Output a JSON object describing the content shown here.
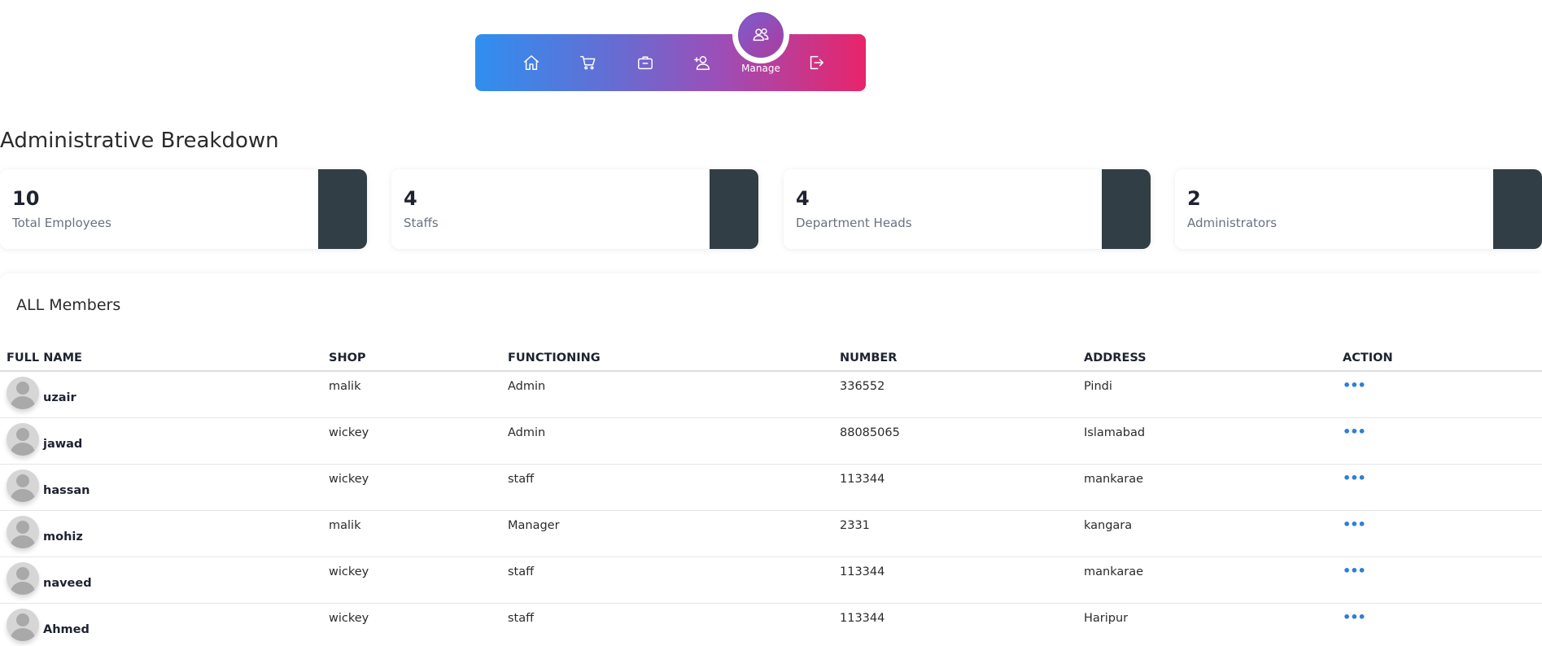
{
  "nav": {
    "items": [
      {
        "icon": "home-icon"
      },
      {
        "icon": "cart-icon"
      },
      {
        "icon": "briefcase-icon"
      },
      {
        "icon": "add-user-icon"
      },
      {
        "icon": "logout-icon"
      }
    ],
    "active": {
      "icon": "users-icon",
      "label": "Manage"
    },
    "gradient": [
      "#2f8ff0",
      "#e8246a"
    ]
  },
  "page": {
    "title": "Administrative Breakdown"
  },
  "stats": [
    {
      "value": "10",
      "label": "Total Employees"
    },
    {
      "value": "4",
      "label": "Staffs"
    },
    {
      "value": "4",
      "label": "Department Heads"
    },
    {
      "value": "2",
      "label": "Administrators"
    }
  ],
  "members": {
    "title": "ALL Members",
    "columns": [
      "FULL NAME",
      "SHOP",
      "FUNCTIONING",
      "NUMBER",
      "ADDRESS",
      "ACTION"
    ],
    "rows": [
      {
        "name": "uzair",
        "shop": "malik",
        "functioning": "Admin",
        "number": "336552",
        "address": "Pindi"
      },
      {
        "name": "jawad",
        "shop": "wickey",
        "functioning": "Admin",
        "number": "88085065",
        "address": "Islamabad"
      },
      {
        "name": "hassan",
        "shop": "wickey",
        "functioning": "staff",
        "number": "113344",
        "address": "mankarae"
      },
      {
        "name": "mohiz",
        "shop": "malik",
        "functioning": "Manager",
        "number": "2331",
        "address": "kangara"
      },
      {
        "name": "naveed",
        "shop": "wickey",
        "functioning": "staff",
        "number": "113344",
        "address": "mankarae"
      },
      {
        "name": "Ahmed",
        "shop": "wickey",
        "functioning": "staff",
        "number": "113344",
        "address": "Haripur"
      }
    ],
    "action_glyph": "•••"
  },
  "colors": {
    "accent": "#2f7ed8",
    "card_block": "#323e45"
  }
}
